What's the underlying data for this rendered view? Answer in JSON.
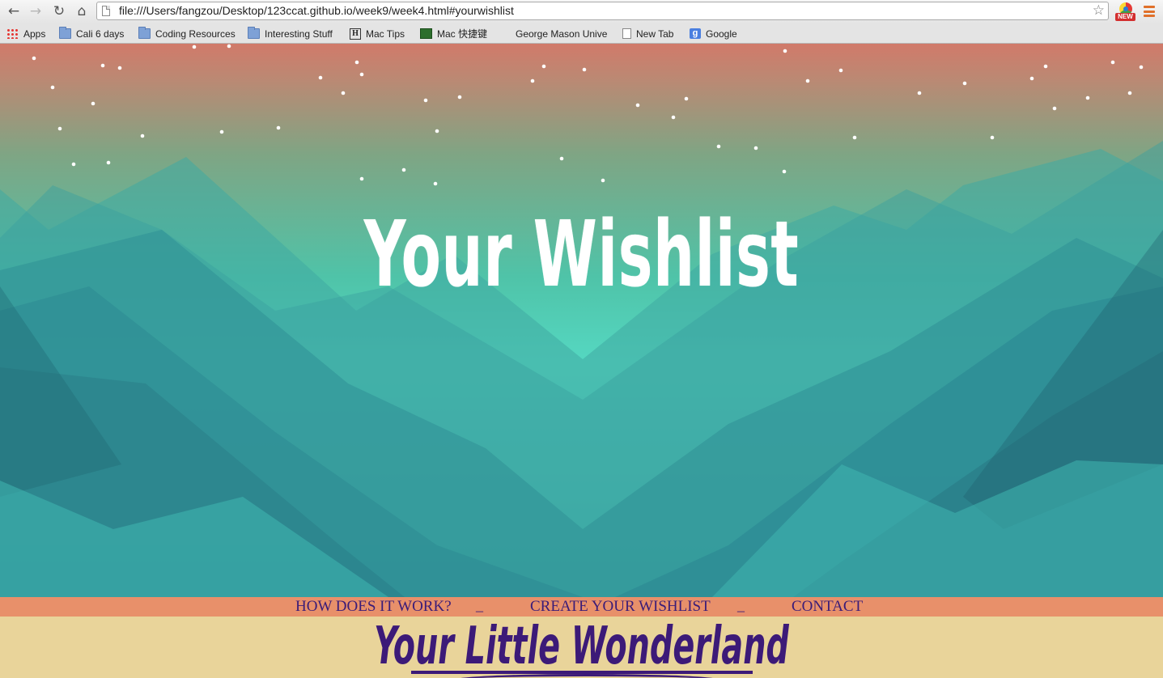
{
  "browser": {
    "url": "file:///Users/fangzou/Desktop/123ccat.github.io/week9/week4.html#yourwishlist",
    "extension_badge": "NEW",
    "bookmarks": [
      {
        "label": "Apps",
        "icon": "apps-grid-icon"
      },
      {
        "label": "Cali 6 days",
        "icon": "folder-icon"
      },
      {
        "label": "Coding Resources",
        "icon": "folder-icon"
      },
      {
        "label": "Interesting Stuff",
        "icon": "folder-icon"
      },
      {
        "label": "Mac Tips",
        "icon": "h-box-icon"
      },
      {
        "label": "Mac 快捷键",
        "icon": "green-box-icon"
      },
      {
        "label": "George Mason Unive",
        "icon": "none"
      },
      {
        "label": "New Tab",
        "icon": "page-icon"
      },
      {
        "label": "Google",
        "icon": "google-icon"
      }
    ]
  },
  "hero": {
    "title": "Your Wishlist"
  },
  "nav": {
    "links": [
      "HOW DOES IT WORK?",
      "CREATE YOUR WISHLIST",
      "CONTACT"
    ],
    "separator": "_"
  },
  "brand": {
    "name": "Your Little Wonderland"
  },
  "colors": {
    "sky_top": "#d17a6a",
    "mountain_teal": "#55d8c2",
    "nav_bar": "#e8906a",
    "nav_text": "#3a1c78",
    "brand_band": "#e9d49a",
    "brand_text": "#3c1a78"
  }
}
